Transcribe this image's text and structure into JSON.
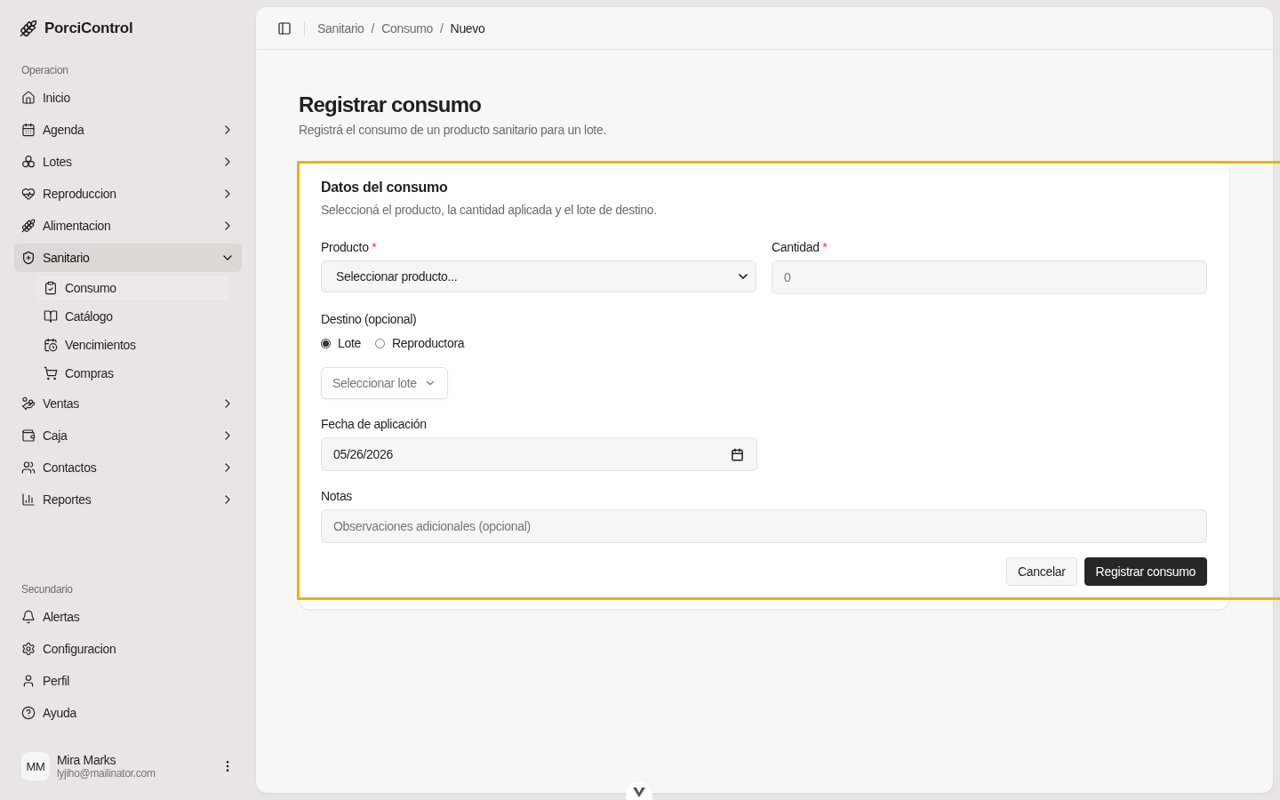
{
  "brand": {
    "name": "PorciControl"
  },
  "sidebar": {
    "sections": [
      {
        "title": "Operacion",
        "items": [
          {
            "label": "Inicio",
            "kind": "link",
            "selected": false
          },
          {
            "label": "Agenda",
            "kind": "group",
            "expanded": false,
            "selected": false
          },
          {
            "label": "Lotes",
            "kind": "group",
            "expanded": false,
            "selected": false
          },
          {
            "label": "Reproduccion",
            "kind": "group",
            "expanded": false,
            "selected": false
          },
          {
            "label": "Alimentacion",
            "kind": "group",
            "expanded": false,
            "selected": false
          },
          {
            "label": "Sanitario",
            "kind": "group",
            "expanded": true,
            "selected": true,
            "children": [
              {
                "label": "Consumo",
                "selected": true
              },
              {
                "label": "Catálogo",
                "selected": false
              },
              {
                "label": "Vencimientos",
                "selected": false
              },
              {
                "label": "Compras",
                "selected": false
              }
            ]
          },
          {
            "label": "Ventas",
            "kind": "group",
            "expanded": false,
            "selected": false
          },
          {
            "label": "Caja",
            "kind": "group",
            "expanded": false,
            "selected": false
          },
          {
            "label": "Contactos",
            "kind": "group",
            "expanded": false,
            "selected": false
          },
          {
            "label": "Reportes",
            "kind": "group",
            "expanded": false,
            "selected": false
          }
        ]
      },
      {
        "title": "Secundario",
        "items": [
          {
            "label": "Alertas",
            "kind": "link",
            "selected": false
          },
          {
            "label": "Configuracion",
            "kind": "link",
            "selected": false
          },
          {
            "label": "Perfil",
            "kind": "link",
            "selected": false
          },
          {
            "label": "Ayuda",
            "kind": "link",
            "selected": false
          }
        ]
      }
    ]
  },
  "user": {
    "initials": "MM",
    "name": "Mira Marks",
    "email": "lyjiho@mailinator.com"
  },
  "breadcrumb": {
    "separator": "/",
    "items": [
      "Sanitario",
      "Consumo",
      "Nuevo"
    ]
  },
  "page": {
    "title": "Registrar consumo",
    "subtitle": "Registrá el consumo de un producto sanitario para un lote."
  },
  "card": {
    "title": "Datos del consumo",
    "subtitle": "Seleccioná el producto, la cantidad aplicada y el lote de destino.",
    "highlighted": true
  },
  "form": {
    "product": {
      "label": "Producto",
      "required_mark": "*",
      "value": "Seleccionar producto..."
    },
    "quantity": {
      "label": "Cantidad",
      "required_mark": "*",
      "placeholder": "0"
    },
    "destination": {
      "label": "Destino (opcional)",
      "options": [
        {
          "label": "Lote",
          "selected": true
        },
        {
          "label": "Reproductora",
          "selected": false
        }
      ],
      "select_placeholder": "Seleccionar lote"
    },
    "date": {
      "label": "Fecha de aplicación",
      "value": "05/26/2026"
    },
    "notes": {
      "label": "Notas",
      "placeholder": "Observaciones adicionales (opcional)"
    }
  },
  "buttons": [
    {
      "label": "Cancelar",
      "kind": "secondary"
    },
    {
      "label": "Registrar consumo",
      "kind": "primary"
    }
  ]
}
